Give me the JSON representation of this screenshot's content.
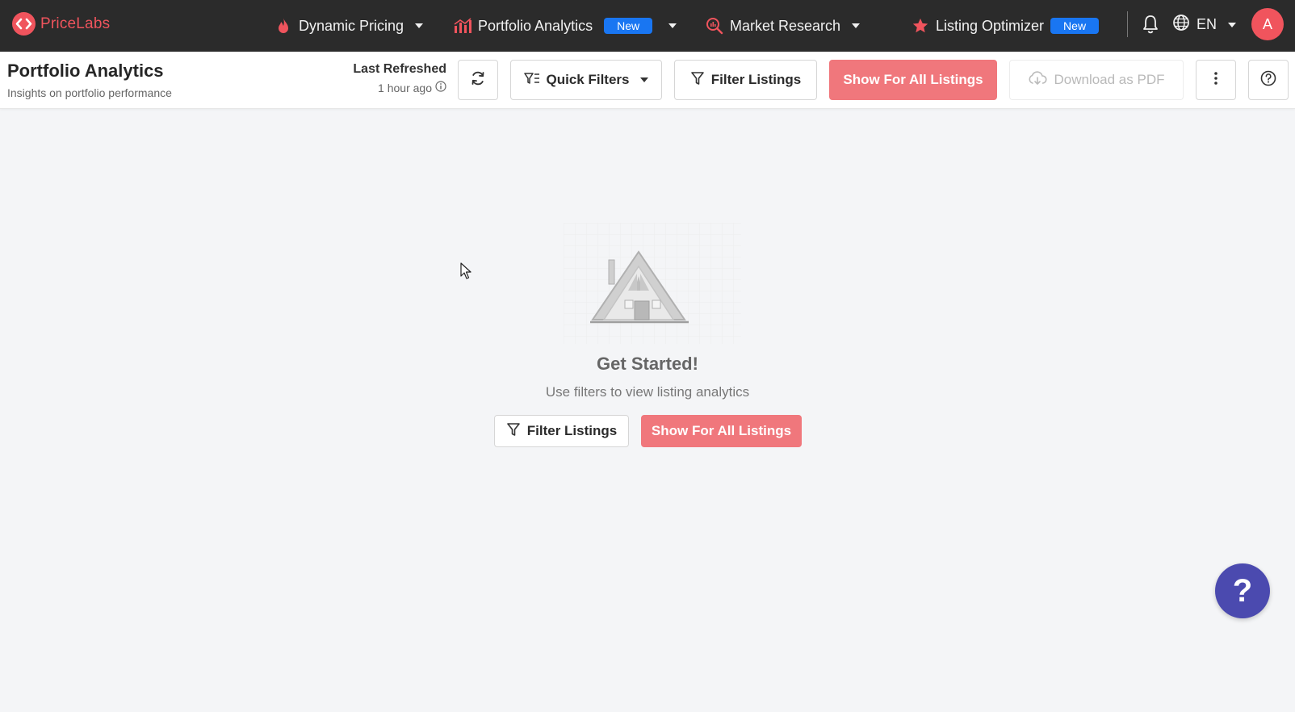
{
  "brand": {
    "name": "PriceLabs",
    "accent": "#f0545d"
  },
  "nav": {
    "items": [
      {
        "label": "Dynamic Pricing",
        "icon": "flame-icon",
        "badge": ""
      },
      {
        "label": "Portfolio Analytics",
        "icon": "bar-chart-icon",
        "badge": "New"
      },
      {
        "label": "Market Research",
        "icon": "search-chart-icon",
        "badge": ""
      },
      {
        "label": "Listing Optimizer",
        "icon": "star-icon",
        "badge": "New"
      }
    ],
    "language": "EN",
    "avatar_initial": "A"
  },
  "header": {
    "title": "Portfolio Analytics",
    "subtitle": "Insights on portfolio performance",
    "last_refreshed_label": "Last Refreshed",
    "last_refreshed_value": "1 hour ago"
  },
  "toolbar": {
    "quick_filters": "Quick Filters",
    "filter_listings": "Filter Listings",
    "show_all": "Show For All Listings",
    "download_pdf": "Download as PDF"
  },
  "empty_state": {
    "title": "Get Started!",
    "subtitle": "Use filters to view listing analytics",
    "filter_button": "Filter Listings",
    "show_all_button": "Show For All Listings"
  },
  "help_fab": "?"
}
